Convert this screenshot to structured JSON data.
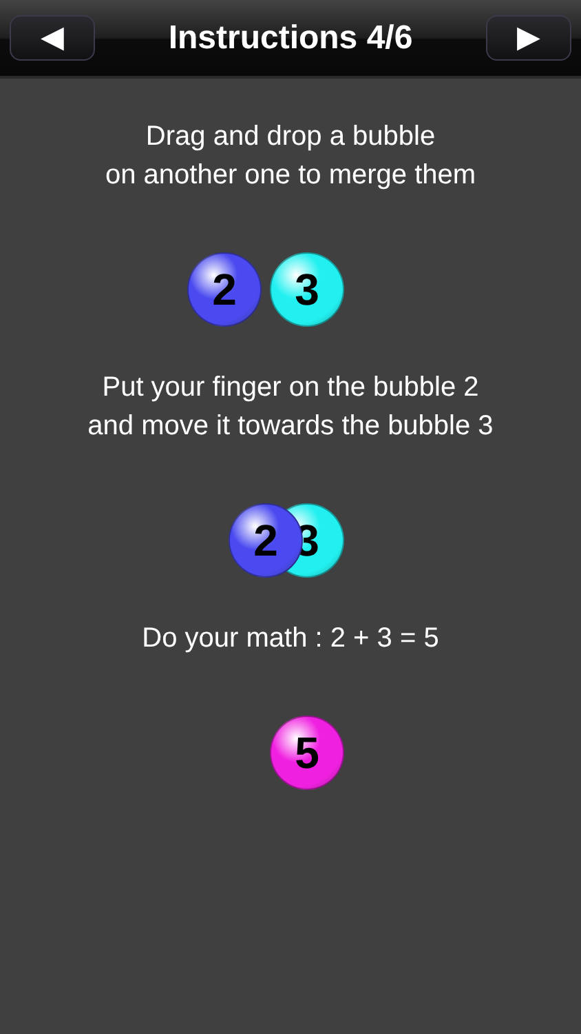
{
  "header": {
    "title": "Instructions 4/6",
    "back_button": "◀",
    "next_button": "▶"
  },
  "sections": [
    {
      "kind": "text",
      "lines": [
        "Drag and drop a bubble",
        "on another one to merge them"
      ]
    },
    {
      "kind": "bubbles",
      "overlap": false,
      "bubbles": [
        {
          "label": "2",
          "color": "#4a4af0"
        },
        {
          "label": "3",
          "color": "#22f0f0"
        }
      ]
    },
    {
      "kind": "text",
      "lines": [
        "Put your finger on the bubble 2",
        "and move it towards the bubble 3"
      ]
    },
    {
      "kind": "bubbles",
      "overlap": true,
      "bubbles": [
        {
          "label": "2",
          "color": "#4a4af0"
        },
        {
          "label": "3",
          "color": "#22f0f0"
        }
      ]
    },
    {
      "kind": "text",
      "lines": [
        "Do your math : 2 + 3 = 5"
      ]
    },
    {
      "kind": "bubbles",
      "bubbles": [
        {
          "label": "5",
          "color": "#f020e0"
        }
      ]
    }
  ]
}
